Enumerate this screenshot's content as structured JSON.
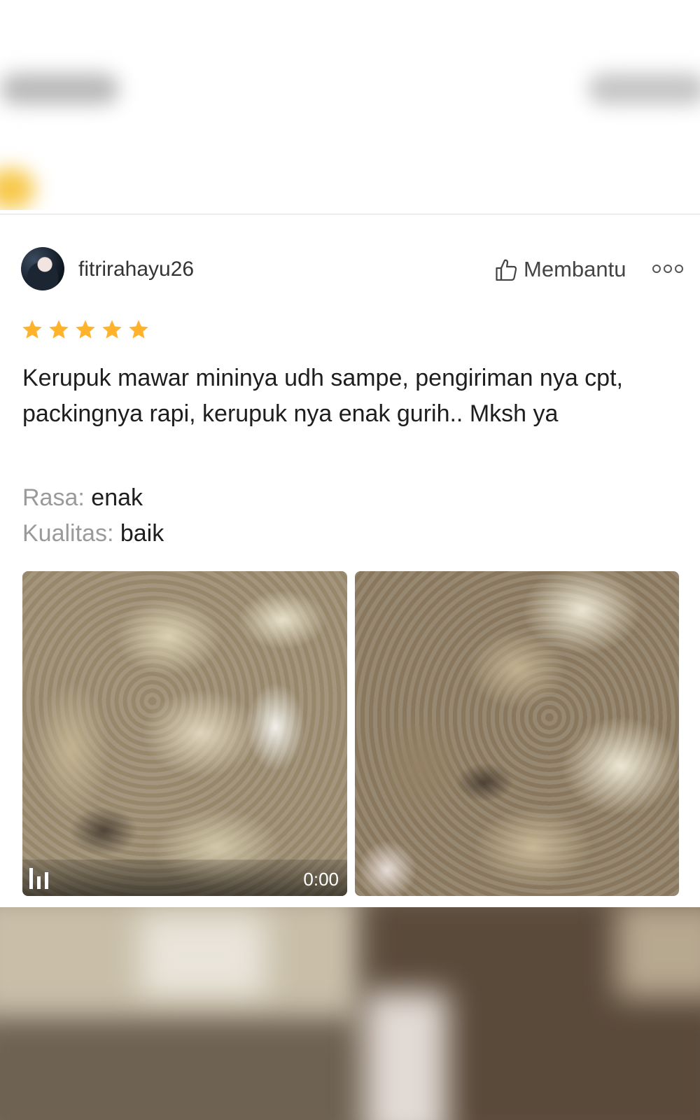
{
  "review": {
    "username": "fitrirahayu26",
    "helpful_label": "Membantu",
    "rating": 5,
    "max_rating": 5,
    "text": "Kerupuk mawar mininya udh sampe, pengiriman nya cpt, packingnya rapi, kerupuk nya enak gurih.. Mksh ya",
    "attributes": [
      {
        "key": "Rasa:",
        "value": "enak"
      },
      {
        "key": "Kualitas:",
        "value": "baik"
      }
    ],
    "media": {
      "video_duration": "0:00"
    }
  },
  "icons": {
    "helpful": "thumbs-up-icon",
    "more": "more-options-icon",
    "star": "star-icon",
    "video": "video-bars-icon"
  },
  "colors": {
    "star": "#FFB22C",
    "text_primary": "#1E1E1E",
    "text_secondary": "#9A9A9A"
  }
}
